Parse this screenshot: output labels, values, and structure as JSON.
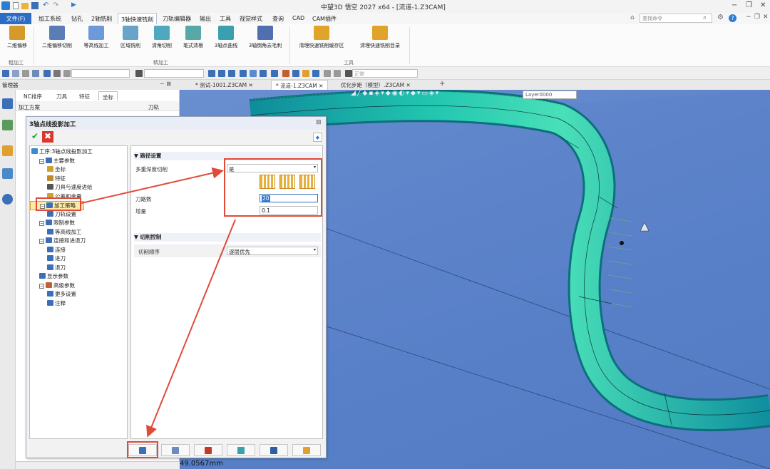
{
  "window": {
    "title": "中望3D 悟空 2027 x64 - [流道-1.Z3CAM]"
  },
  "menu": {
    "file": "文件(F)",
    "items": [
      "加工系统",
      "钻孔",
      "2轴铣削",
      "3轴快速铣削",
      "刀轨编辑器",
      "输出",
      "工具",
      "视觉样式",
      "查询",
      "CAD",
      "CAM插件"
    ],
    "search_placeholder": "查找命令"
  },
  "ribbon": {
    "buttons": [
      {
        "label": "二维偏移",
        "color": "#d49a2a"
      },
      {
        "label": "二维偏移切削",
        "color": "#5a7db8"
      },
      {
        "label": "等高线加工",
        "color": "#6c9ad8"
      },
      {
        "label": "区域铣削",
        "color": "#6aa3c9"
      },
      {
        "label": "清角切削",
        "color": "#4fa7c0"
      },
      {
        "label": "笔式清根",
        "color": "#58a8a8"
      },
      {
        "label": "3轴点曲线",
        "color": "#3aa0b0"
      },
      {
        "label": "3轴倒角去毛刺",
        "color": "#4f6fb0"
      },
      {
        "label": "清理快速铣削缓存区",
        "color": "#e0a42a"
      },
      {
        "label": "清理快速铣削目录",
        "color": "#e0a42a"
      }
    ],
    "groups": {
      "rough": "粗加工",
      "finish": "精加工",
      "tools": "工具"
    }
  },
  "toolbar": {
    "combo_placeholder": "正常"
  },
  "doc_tabs": [
    {
      "label": "* 测试-1001.Z3CAM ✕",
      "active": false
    },
    {
      "label": "* 流道-1.Z3CAM ✕",
      "active": true
    },
    {
      "label": "优化步距（模型）.Z3CAM ✕",
      "active": false
    }
  ],
  "manager": {
    "title": "管理器",
    "tabs": [
      "NC排序",
      "刀具",
      "特征",
      "坐标"
    ],
    "columns": [
      "加工方案",
      "刀轨"
    ]
  },
  "viewport": {
    "layer": "Layer0000"
  },
  "dialog": {
    "title": "3轴点线投影加工",
    "ok": "✔",
    "cancel": "✖",
    "tree": [
      {
        "label": "工序:3轴点线投影加工",
        "level": 0,
        "icon": "#3b8bd0"
      },
      {
        "label": "主要参数",
        "level": 1,
        "expand": "−",
        "icon": "#3b6fb8"
      },
      {
        "label": "坐标",
        "level": 2,
        "icon": "#d0a030"
      },
      {
        "label": "特征",
        "level": 2,
        "icon": "#c08a2a"
      },
      {
        "label": "刀具与速度进给",
        "level": 2,
        "icon": "#555555"
      },
      {
        "label": "公差和余量",
        "level": 2,
        "icon": "#d0a030"
      },
      {
        "label": "加工策略",
        "level": 1,
        "expand": "−",
        "icon": "#3b6fb8",
        "selected": true
      },
      {
        "label": "刀轨设置",
        "level": 2,
        "icon": "#3b6fb8"
      },
      {
        "label": "限制参数",
        "level": 1,
        "expand": "−",
        "icon": "#3b6fb8"
      },
      {
        "label": "等高线加工",
        "level": 2,
        "icon": "#3b6fb8"
      },
      {
        "label": "连接和进退刀",
        "level": 1,
        "expand": "−",
        "icon": "#3b6fb8"
      },
      {
        "label": "连接",
        "level": 2,
        "icon": "#3b6fb8"
      },
      {
        "label": "进刀",
        "level": 2,
        "icon": "#3b6fb8"
      },
      {
        "label": "退刀",
        "level": 2,
        "icon": "#3b6fb8"
      },
      {
        "label": "显示参数",
        "level": 1,
        "icon": "#3b6fb8"
      },
      {
        "label": "高级参数",
        "level": 1,
        "expand": "−",
        "icon": "#c0603a"
      },
      {
        "label": "更多设置",
        "level": 2,
        "icon": "#3b6fb8"
      },
      {
        "label": "注释",
        "level": 2,
        "icon": "#3b6fb8"
      }
    ],
    "path_section": "路径设置",
    "multi_depth_label": "多重深度切削",
    "multi_depth_value": "是",
    "path_count_label": "刀路数",
    "path_count_value": "20",
    "increment_label": "增量",
    "increment_value": "0.1",
    "cut_section": "切削控制",
    "cut_order_label": "切削顺序",
    "cut_order_value": "逐层优先"
  },
  "status": {
    "measure": "49.0567mm"
  }
}
